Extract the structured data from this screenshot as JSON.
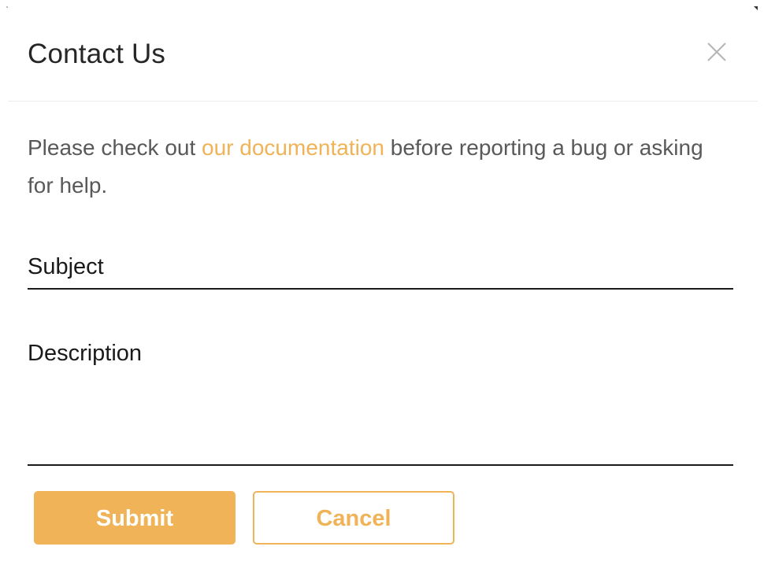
{
  "dialog": {
    "title": "Contact Us",
    "close_icon": "close-icon"
  },
  "intro": {
    "prefix": "Please check out ",
    "link_text": "our documentation",
    "suffix": " before reporting a bug or asking for help."
  },
  "form": {
    "subject_label": "Subject",
    "subject_value": "",
    "description_label": "Description",
    "description_value": ""
  },
  "actions": {
    "submit_label": "Submit",
    "cancel_label": "Cancel"
  },
  "colors": {
    "accent": "#f0b357",
    "text_primary": "#1a1a1a",
    "text_secondary": "#595959"
  }
}
